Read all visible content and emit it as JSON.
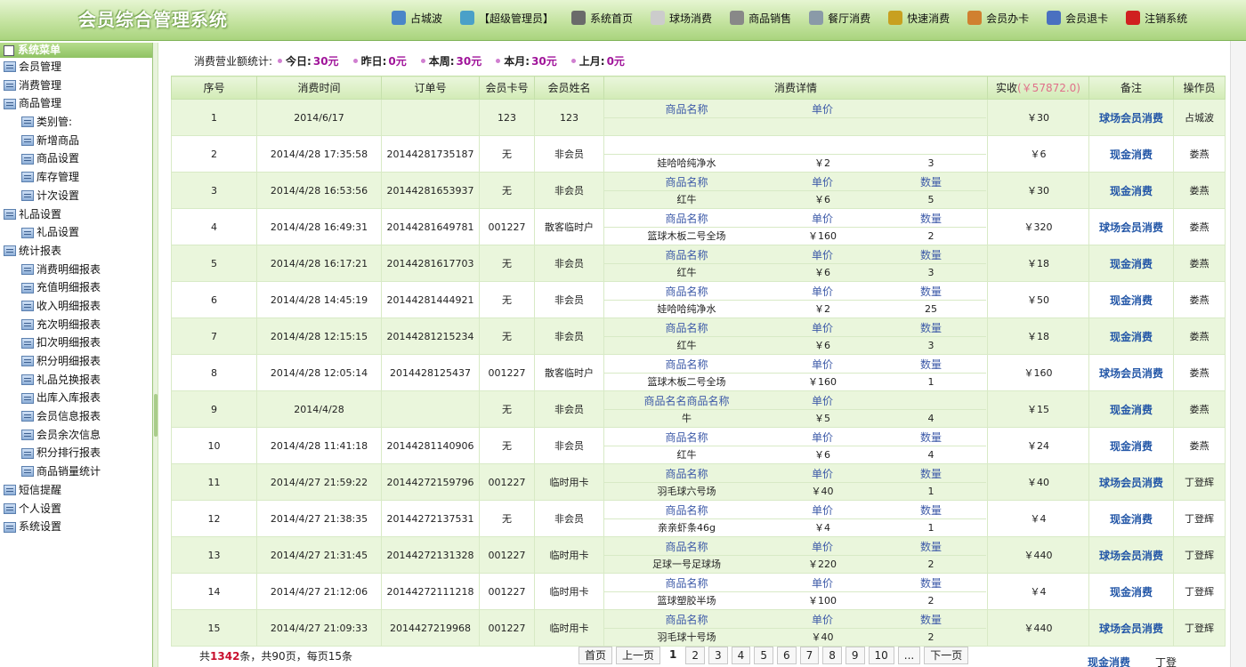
{
  "header": {
    "app_title": "会员综合管理系统",
    "nav": [
      {
        "label": "占城波",
        "icon": "user-icon",
        "color": "#4a86c8"
      },
      {
        "label": "【超级管理员】",
        "icon": "admin-icon",
        "color": "#4aa0c8"
      },
      {
        "label": "系统首页",
        "icon": "home-icon",
        "color": "#6a6a6a"
      },
      {
        "label": "球场消费",
        "icon": "ball-icon",
        "color": "#cccccc"
      },
      {
        "label": "商品销售",
        "icon": "goods-icon",
        "color": "#888888"
      },
      {
        "label": "餐厅消费",
        "icon": "restaurant-icon",
        "color": "#8a9aa8"
      },
      {
        "label": "快速消费",
        "icon": "fast-icon",
        "color": "#c8a020"
      },
      {
        "label": "会员办卡",
        "icon": "card-icon",
        "color": "#d08030"
      },
      {
        "label": "会员退卡",
        "icon": "return-card-icon",
        "color": "#4a70c0"
      },
      {
        "label": "注销系统",
        "icon": "logout-icon",
        "color": "#d02020"
      }
    ]
  },
  "sidebar": {
    "title": "系统菜单",
    "items": [
      {
        "label": "会员管理",
        "level": "top"
      },
      {
        "label": "消费管理",
        "level": "top"
      },
      {
        "label": "商品管理",
        "level": "top"
      },
      {
        "label": "类别管:",
        "level": "sub"
      },
      {
        "label": "新增商品",
        "level": "sub"
      },
      {
        "label": "商品设置",
        "level": "sub"
      },
      {
        "label": "库存管理",
        "level": "sub"
      },
      {
        "label": "计次设置",
        "level": "sub"
      },
      {
        "label": "礼品设置",
        "level": "top"
      },
      {
        "label": "礼品设置",
        "level": "sub"
      },
      {
        "label": "统计报表",
        "level": "top"
      },
      {
        "label": "消费明细报表",
        "level": "sub"
      },
      {
        "label": "充值明细报表",
        "level": "sub"
      },
      {
        "label": "收入明细报表",
        "level": "sub"
      },
      {
        "label": "充次明细报表",
        "level": "sub"
      },
      {
        "label": "扣次明细报表",
        "level": "sub"
      },
      {
        "label": "积分明细报表",
        "level": "sub"
      },
      {
        "label": "礼品兑换报表",
        "level": "sub"
      },
      {
        "label": "出库入库报表",
        "level": "sub"
      },
      {
        "label": "会员信息报表",
        "level": "sub"
      },
      {
        "label": "会员余次信息",
        "level": "sub"
      },
      {
        "label": "积分排行报表",
        "level": "sub"
      },
      {
        "label": "商品销量统计",
        "level": "sub"
      },
      {
        "label": "短信提醒",
        "level": "top"
      },
      {
        "label": "个人设置",
        "level": "top"
      },
      {
        "label": "系统设置",
        "level": "top"
      }
    ]
  },
  "stats": {
    "label": "消费营业额统计:",
    "items": [
      {
        "name": "今日:",
        "value": "30元"
      },
      {
        "name": "昨日:",
        "value": "0元"
      },
      {
        "name": "本周:",
        "value": "30元"
      },
      {
        "name": "本月:",
        "value": "30元"
      },
      {
        "name": "上月:",
        "value": "0元"
      }
    ]
  },
  "table": {
    "headers": [
      "序号",
      "消费时间",
      "订单号",
      "会员卡号",
      "会员姓名",
      "消费详情",
      "实收",
      "备注",
      "操作员"
    ],
    "paid_total": "(￥57872.0)",
    "rows": [
      {
        "no": "1",
        "time": "2014/6/17",
        "order": "",
        "card": "123",
        "name": "123",
        "dh": [
          "商品名称",
          "单价",
          ""
        ],
        "dv": [
          "",
          "",
          ""
        ],
        "paid": "￥30",
        "remark": "球场会员消费",
        "op": "占城波"
      },
      {
        "no": "2",
        "time": "2014/4/28 17:35:58",
        "order": "20144281735187",
        "card": "无",
        "name": "非会员",
        "dh": [
          "",
          "",
          ""
        ],
        "dv": [
          "娃哈哈纯净水",
          "￥2",
          "3"
        ],
        "paid": "￥6",
        "remark": "现金消费",
        "op": "娄燕"
      },
      {
        "no": "3",
        "time": "2014/4/28 16:53:56",
        "order": "20144281653937",
        "card": "无",
        "name": "非会员",
        "dh": [
          "商品名称",
          "单价",
          "数量"
        ],
        "dv": [
          "红牛",
          "￥6",
          "5"
        ],
        "paid": "￥30",
        "remark": "现金消费",
        "op": "娄燕"
      },
      {
        "no": "4",
        "time": "2014/4/28 16:49:31",
        "order": "20144281649781",
        "card": "001227",
        "name": "散客临时户",
        "dh": [
          "商品名称",
          "单价",
          "数量"
        ],
        "dv": [
          "篮球木板二号全场",
          "￥160",
          "2"
        ],
        "paid": "￥320",
        "remark": "球场会员消费",
        "op": "娄燕"
      },
      {
        "no": "5",
        "time": "2014/4/28 16:17:21",
        "order": "20144281617703",
        "card": "无",
        "name": "非会员",
        "dh": [
          "商品名称",
          "单价",
          "数量"
        ],
        "dv": [
          "红牛",
          "￥6",
          "3"
        ],
        "paid": "￥18",
        "remark": "现金消费",
        "op": "娄燕"
      },
      {
        "no": "6",
        "time": "2014/4/28 14:45:19",
        "order": "20144281444921",
        "card": "无",
        "name": "非会员",
        "dh": [
          "商品名称",
          "单价",
          "数量"
        ],
        "dv": [
          "娃哈哈纯净水",
          "￥2",
          "25"
        ],
        "paid": "￥50",
        "remark": "现金消费",
        "op": "娄燕"
      },
      {
        "no": "7",
        "time": "2014/4/28 12:15:15",
        "order": "20144281215234",
        "card": "无",
        "name": "非会员",
        "dh": [
          "商品名称",
          "单价",
          "数量"
        ],
        "dv": [
          "红牛",
          "￥6",
          "3"
        ],
        "paid": "￥18",
        "remark": "现金消费",
        "op": "娄燕"
      },
      {
        "no": "8",
        "time": "2014/4/28 12:05:14",
        "order": "2014428125437",
        "card": "001227",
        "name": "散客临时户",
        "dh": [
          "商品名称",
          "单价",
          "数量"
        ],
        "dv": [
          "篮球木板二号全场",
          "￥160",
          "1"
        ],
        "paid": "￥160",
        "remark": "球场会员消费",
        "op": "娄燕"
      },
      {
        "no": "9",
        "time": "2014/4/28",
        "order": "",
        "card": "无",
        "name": "非会员",
        "dh": [
          "商品名名商品名称",
          "单价",
          ""
        ],
        "dv": [
          "牛",
          "￥5",
          "4"
        ],
        "paid": "￥15",
        "remark": "现金消费",
        "op": "娄燕"
      },
      {
        "no": "10",
        "time": "2014/4/28 11:41:18",
        "order": "20144281140906",
        "card": "无",
        "name": "非会员",
        "dh": [
          "商品名称",
          "单价",
          "数量"
        ],
        "dv": [
          "红牛",
          "￥6",
          "4"
        ],
        "paid": "￥24",
        "remark": "现金消费",
        "op": "娄燕"
      },
      {
        "no": "11",
        "time": "2014/4/27 21:59:22",
        "order": "20144272159796",
        "card": "001227",
        "name": "临时用卡",
        "dh": [
          "商品名称",
          "单价",
          "数量"
        ],
        "dv": [
          "羽毛球六号场",
          "￥40",
          "1"
        ],
        "paid": "￥40",
        "remark": "球场会员消费",
        "op": "丁登辉"
      },
      {
        "no": "12",
        "time": "2014/4/27 21:38:35",
        "order": "20144272137531",
        "card": "无",
        "name": "非会员",
        "dh": [
          "商品名称",
          "单价",
          "数量"
        ],
        "dv": [
          "亲亲虾条46g",
          "￥4",
          "1"
        ],
        "paid": "￥4",
        "remark": "现金消费",
        "op": "丁登辉"
      },
      {
        "no": "13",
        "time": "2014/4/27 21:31:45",
        "order": "20144272131328",
        "card": "001227",
        "name": "临时用卡",
        "dh": [
          "商品名称",
          "单价",
          "数量"
        ],
        "dv": [
          "足球一号足球场",
          "￥220",
          "2"
        ],
        "paid": "￥440",
        "remark": "球场会员消费",
        "op": "丁登辉"
      },
      {
        "no": "14",
        "time": "2014/4/27 21:12:06",
        "order": "20144272111218",
        "card": "001227",
        "name": "临时用卡",
        "dh": [
          "商品名称",
          "单价",
          "数量"
        ],
        "dv": [
          "篮球塑胶半场",
          "￥100",
          "2"
        ],
        "paid": "￥4",
        "remark": "现金消费",
        "op": "丁登辉"
      },
      {
        "no": "15",
        "time": "2014/4/27 21:09:33",
        "order": "2014427219968",
        "card": "001227",
        "name": "临时用卡",
        "dh": [
          "商品名称",
          "单价",
          "数量"
        ],
        "dv": [
          "羽毛球十号场",
          "￥40",
          "2"
        ],
        "paid": "￥440",
        "remark": "球场会员消费",
        "op": "丁登辉"
      }
    ]
  },
  "footer": {
    "total_prefix": "共",
    "total_count": "1342",
    "total_suffix": "条，共90页，每页15条",
    "pager": [
      "首页",
      "上一页",
      "1",
      "2",
      "3",
      "4",
      "5",
      "6",
      "7",
      "8",
      "9",
      "10",
      "...",
      "下一页"
    ],
    "current_page": "1"
  },
  "overflow_row": {
    "remark": "现金消费",
    "op": "丁登辉"
  }
}
